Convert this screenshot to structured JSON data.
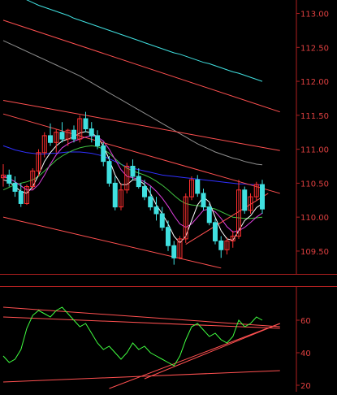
{
  "price_axis": {
    "ticks": [
      "113.00",
      "112.50",
      "112.00",
      "111.50",
      "111.00",
      "110.50",
      "110.00",
      "109.50"
    ]
  },
  "indicator_axis": {
    "ticks": [
      "60",
      "40",
      "20"
    ],
    "panel_marker": "回"
  },
  "colors": {
    "background": "#000000",
    "axis": "#b02020",
    "tick_text": "#e04040",
    "candle_up": "#ff3030",
    "candle_down": "#40e0e0",
    "ma_short": "#ffffff",
    "ma_mid": "#e040e0",
    "ma_long": "#40c040",
    "ma_blue": "#3030ff",
    "ma_cyan": "#40e0e0",
    "ma_gray": "#909090",
    "trendline": "#ff5050",
    "oscillator": "#40ff40"
  },
  "chart_data": [
    {
      "type": "candlestick",
      "title": "",
      "ylim": [
        109.2,
        113.15
      ],
      "y_ticks": [
        109.5,
        110.0,
        110.5,
        111.0,
        111.5,
        112.0,
        112.5,
        113.0
      ],
      "grid": false,
      "candles": [
        [
          110.58,
          110.78,
          110.45,
          110.62
        ],
        [
          110.62,
          110.7,
          110.45,
          110.5
        ],
        [
          110.5,
          110.6,
          110.3,
          110.38
        ],
        [
          110.38,
          110.5,
          110.15,
          110.2
        ],
        [
          110.2,
          110.48,
          110.18,
          110.45
        ],
        [
          110.45,
          110.72,
          110.4,
          110.68
        ],
        [
          110.68,
          111.0,
          110.6,
          110.95
        ],
        [
          110.95,
          111.25,
          110.88,
          111.2
        ],
        [
          111.2,
          111.38,
          111.05,
          111.1
        ],
        [
          111.1,
          111.3,
          110.95,
          111.25
        ],
        [
          111.25,
          111.4,
          111.1,
          111.15
        ],
        [
          111.15,
          111.3,
          111.05,
          111.28
        ],
        [
          111.28,
          111.35,
          111.1,
          111.15
        ],
        [
          111.15,
          111.5,
          111.1,
          111.45
        ],
        [
          111.45,
          111.55,
          111.25,
          111.3
        ],
        [
          111.3,
          111.4,
          111.1,
          111.2
        ],
        [
          111.2,
          111.28,
          111.0,
          111.05
        ],
        [
          111.05,
          111.1,
          110.75,
          110.82
        ],
        [
          110.82,
          110.9,
          110.45,
          110.5
        ],
        [
          110.5,
          110.6,
          110.1,
          110.15
        ],
        [
          110.15,
          110.5,
          110.1,
          110.4
        ],
        [
          110.4,
          110.8,
          110.35,
          110.75
        ],
        [
          110.75,
          110.85,
          110.55,
          110.6
        ],
        [
          110.6,
          110.72,
          110.42,
          110.45
        ],
        [
          110.45,
          110.55,
          110.25,
          110.3
        ],
        [
          110.3,
          110.45,
          110.1,
          110.15
        ],
        [
          110.15,
          110.3,
          109.95,
          110.05
        ],
        [
          110.05,
          110.15,
          109.8,
          109.85
        ],
        [
          109.85,
          109.95,
          109.5,
          109.58
        ],
        [
          109.58,
          109.65,
          109.3,
          109.4
        ],
        [
          109.4,
          109.72,
          109.38,
          109.68
        ],
        [
          109.68,
          110.35,
          109.62,
          110.3
        ],
        [
          110.3,
          110.6,
          110.25,
          110.55
        ],
        [
          110.55,
          110.62,
          110.3,
          110.35
        ],
        [
          110.35,
          110.42,
          110.1,
          110.15
        ],
        [
          110.15,
          110.2,
          109.88,
          109.92
        ],
        [
          109.92,
          109.98,
          109.6,
          109.65
        ],
        [
          109.65,
          109.72,
          109.4,
          109.52
        ],
        [
          109.52,
          109.7,
          109.45,
          109.65
        ],
        [
          109.65,
          109.8,
          109.55,
          109.72
        ],
        [
          109.72,
          110.55,
          109.68,
          110.4
        ],
        [
          110.4,
          110.45,
          110.05,
          110.1
        ],
        [
          110.1,
          110.35,
          110.05,
          110.3
        ],
        [
          110.3,
          110.52,
          110.25,
          110.48
        ],
        [
          110.48,
          110.55,
          110.05,
          110.12
        ]
      ],
      "ma_white": [
        110.55,
        110.52,
        110.45,
        110.38,
        110.35,
        110.45,
        110.62,
        110.82,
        110.95,
        111.05,
        111.12,
        111.15,
        111.18,
        111.24,
        111.26,
        111.24,
        111.18,
        111.05,
        110.85,
        110.62,
        110.48,
        110.48,
        110.55,
        110.55,
        110.48,
        110.35,
        110.18,
        110.05,
        109.9,
        109.72,
        109.62,
        109.72,
        109.95,
        110.18,
        110.3,
        110.22,
        110.0,
        109.8,
        109.68,
        109.66,
        109.8,
        109.95,
        110.02,
        110.14,
        110.2
      ],
      "ma_magenta": [
        110.6,
        110.57,
        110.52,
        110.46,
        110.4,
        110.4,
        110.48,
        110.62,
        110.78,
        110.92,
        111.02,
        111.08,
        111.12,
        111.15,
        111.18,
        111.2,
        111.18,
        111.12,
        111.0,
        110.85,
        110.7,
        110.6,
        110.58,
        110.56,
        110.52,
        110.46,
        110.38,
        110.28,
        110.16,
        110.02,
        109.9,
        109.85,
        109.9,
        110.0,
        110.1,
        110.12,
        110.08,
        109.98,
        109.86,
        109.78,
        109.8,
        109.85,
        109.92,
        110.0,
        110.06
      ],
      "ma_green": [
        110.4,
        110.44,
        110.48,
        110.5,
        110.52,
        110.55,
        110.6,
        110.68,
        110.76,
        110.84,
        110.9,
        110.95,
        110.99,
        111.02,
        111.04,
        111.05,
        111.04,
        111.0,
        110.94,
        110.86,
        110.78,
        110.72,
        110.68,
        110.65,
        110.62,
        110.58,
        110.53,
        110.47,
        110.4,
        110.32,
        110.25,
        110.2,
        110.18,
        110.17,
        110.16,
        110.14,
        110.12,
        110.08,
        110.04,
        110.0,
        109.99,
        109.98,
        109.98,
        109.99,
        110.0
      ],
      "ma_blue": [
        111.05,
        111.02,
        110.99,
        110.97,
        110.95,
        110.94,
        110.93,
        110.93,
        110.94,
        110.94,
        110.95,
        110.96,
        110.96,
        110.96,
        110.95,
        110.94,
        110.92,
        110.9,
        110.86,
        110.82,
        110.78,
        110.74,
        110.72,
        110.7,
        110.68,
        110.66,
        110.64,
        110.62,
        110.61,
        110.6,
        110.59,
        110.58,
        110.57,
        110.56,
        110.55,
        110.54,
        110.53,
        110.52,
        110.51,
        110.5,
        110.49,
        110.49,
        110.48,
        110.48,
        110.47
      ],
      "ma_cyan": [
        113.35,
        113.32,
        113.28,
        113.24,
        113.2,
        113.16,
        113.12,
        113.09,
        113.06,
        113.03,
        113.0,
        112.97,
        112.93,
        112.9,
        112.87,
        112.84,
        112.81,
        112.78,
        112.75,
        112.72,
        112.69,
        112.66,
        112.63,
        112.6,
        112.57,
        112.54,
        112.51,
        112.48,
        112.45,
        112.42,
        112.4,
        112.37,
        112.34,
        112.31,
        112.28,
        112.26,
        112.23,
        112.2,
        112.17,
        112.14,
        112.12,
        112.09,
        112.06,
        112.03,
        112.0
      ],
      "ma_gray": [
        112.6,
        112.56,
        112.52,
        112.48,
        112.44,
        112.4,
        112.36,
        112.32,
        112.28,
        112.24,
        112.2,
        112.16,
        112.12,
        112.08,
        112.03,
        111.98,
        111.93,
        111.88,
        111.83,
        111.78,
        111.73,
        111.68,
        111.63,
        111.58,
        111.53,
        111.48,
        111.43,
        111.38,
        111.33,
        111.28,
        111.23,
        111.18,
        111.13,
        111.08,
        111.04,
        111.0,
        110.96,
        110.93,
        110.9,
        110.87,
        110.85,
        110.82,
        110.8,
        110.78,
        110.77
      ],
      "trendlines": [
        {
          "from": [
            0,
            112.9
          ],
          "to": [
            47,
            111.55
          ]
        },
        {
          "from": [
            0,
            111.72
          ],
          "to": [
            47,
            110.98
          ]
        },
        {
          "from": [
            0,
            111.52
          ],
          "to": [
            47,
            110.35
          ]
        },
        {
          "from": [
            0,
            110.0
          ],
          "to": [
            37,
            109.25
          ]
        },
        {
          "from": [
            31,
            109.6
          ],
          "to": [
            45,
            110.35
          ]
        }
      ]
    },
    {
      "type": "line",
      "title": "",
      "ylim": [
        16,
        80
      ],
      "y_ticks": [
        20,
        40,
        60
      ],
      "grid": false,
      "values": [
        38,
        34,
        36,
        42,
        55,
        63,
        66,
        64,
        62,
        66,
        68,
        64,
        60,
        56,
        58,
        52,
        46,
        42,
        44,
        40,
        36,
        40,
        46,
        42,
        44,
        40,
        38,
        36,
        34,
        32,
        38,
        48,
        56,
        58,
        54,
        50,
        52,
        48,
        46,
        50,
        60,
        56,
        58,
        62,
        60
      ],
      "trendlines": [
        {
          "from": [
            0,
            68
          ],
          "to": [
            47,
            56
          ]
        },
        {
          "from": [
            0,
            62
          ],
          "to": [
            47,
            55
          ]
        },
        {
          "from": [
            0,
            22
          ],
          "to": [
            47,
            29
          ]
        },
        {
          "from": [
            18,
            18
          ],
          "to": [
            47,
            58
          ]
        },
        {
          "from": [
            24,
            24
          ],
          "to": [
            47,
            58
          ]
        }
      ]
    }
  ]
}
